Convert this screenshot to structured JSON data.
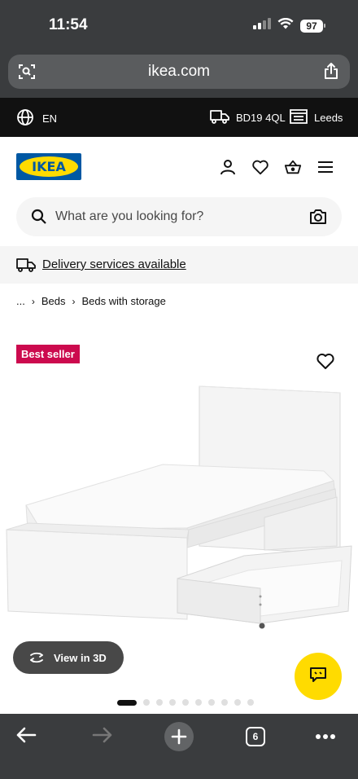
{
  "status_bar": {
    "time": "11:54",
    "battery": "97"
  },
  "browser": {
    "url": "ikea.com",
    "left_icon": "tab-search-icon",
    "right_icon": "share-icon"
  },
  "top_bar": {
    "language": "EN",
    "postcode": "BD19 4QL",
    "store": "Leeds"
  },
  "header": {
    "logo_text": "IKEA",
    "icons": [
      "profile-icon",
      "heart-icon",
      "basket-icon",
      "menu-icon"
    ]
  },
  "search": {
    "placeholder": "What are you looking for?"
  },
  "delivery": {
    "label": "Delivery services available"
  },
  "breadcrumb": {
    "items": [
      "...",
      "Beds",
      "Beds with storage"
    ]
  },
  "product": {
    "badge": "Best seller",
    "view3d_label": "View in 3D",
    "image_count": 10,
    "active_image_index": 0
  },
  "bottom_toolbar": {
    "tab_count": "6"
  },
  "colors": {
    "ikea_blue": "#0058a3",
    "ikea_yellow": "#ffdb00",
    "badge_red": "#cc0a4e",
    "chrome_gray": "#3a3c3e"
  }
}
